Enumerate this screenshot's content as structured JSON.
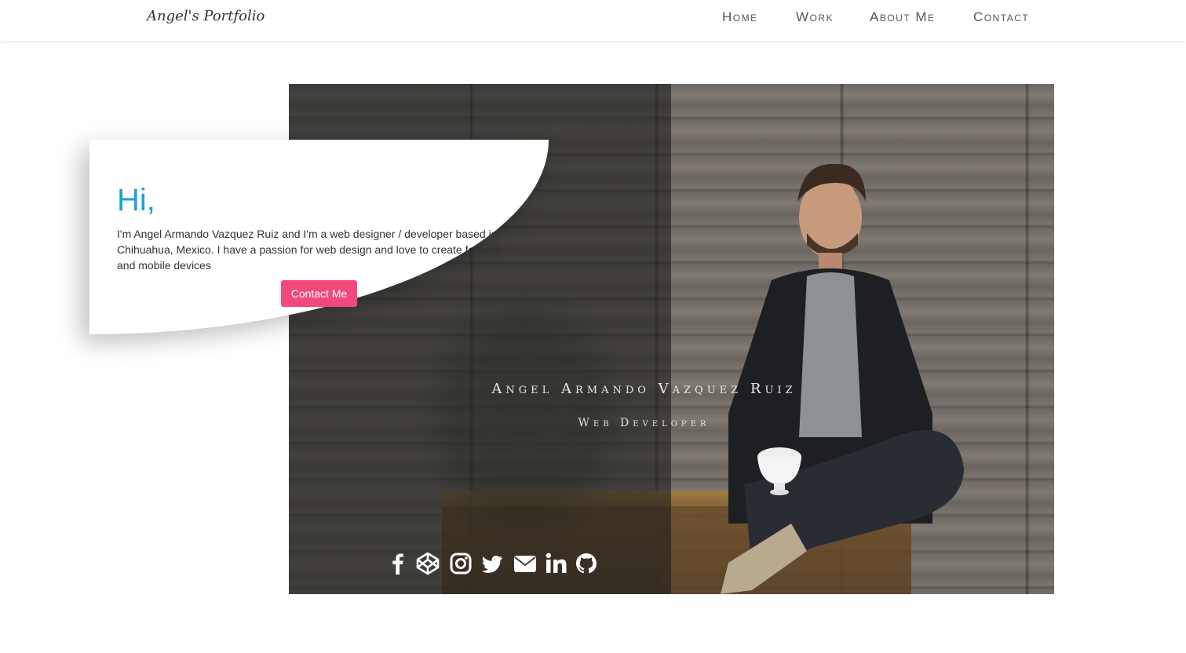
{
  "navbar": {
    "brand": "Angel's Portfolio",
    "links": [
      "Home",
      "Work",
      "About Me",
      "Contact"
    ]
  },
  "intro": {
    "greeting": "Hi,",
    "text": "I'm Angel Armando Vazquez Ruiz and I'm a web designer / developer based in Chihuahua, Mexico. I have a passion for web design and love to create for web and mobile devices",
    "button_label": "Contact Me"
  },
  "hero": {
    "name": "Angel Armando Vazquez Ruiz",
    "role": "Web Developer"
  },
  "socials": [
    "facebook-icon",
    "codepen-icon",
    "instagram-icon",
    "twitter-icon",
    "envelope-icon",
    "linkedin-icon",
    "github-icon"
  ],
  "colors": {
    "accent_blue": "#1aa3db",
    "button_pink": "#f2497d"
  }
}
